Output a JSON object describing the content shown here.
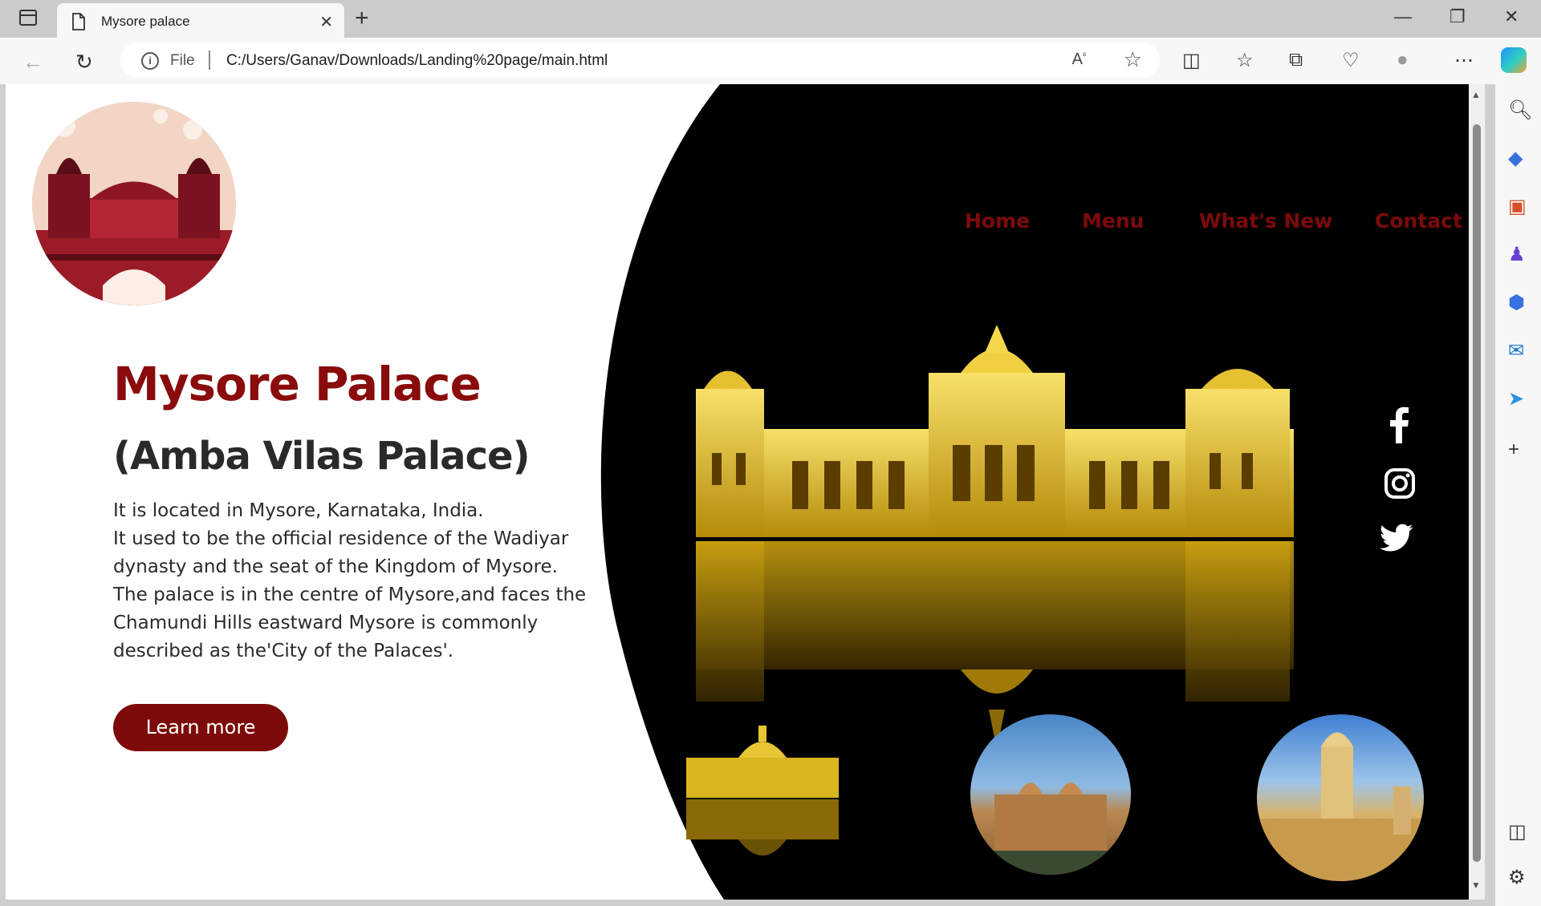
{
  "browser": {
    "tab_title": "Mysore palace",
    "address_scheme": "File",
    "address_url": "C:/Users/Ganav/Downloads/Landing%20page/main.html"
  },
  "nav": {
    "home": "Home",
    "menu": "Menu",
    "whats_new": "What's New",
    "contact": "Contact"
  },
  "hero": {
    "title": "Mysore Palace",
    "subtitle": "(Amba Vilas Palace)",
    "description": "It is located in Mysore, Karnataka, India.\nIt used to be the official residence of the Wadiyar dynasty and the seat of the Kingdom of Mysore.\nThe palace is in the centre of Mysore,and faces the Chamundi Hills eastward Mysore is commonly described as the'City of the Palaces'.",
    "cta_label": "Learn more"
  },
  "social": [
    "facebook-icon",
    "instagram-icon",
    "twitter-icon"
  ],
  "colors": {
    "accent": "#7d0a0a",
    "background_dark": "#000000",
    "gold": "#e8c21a"
  }
}
